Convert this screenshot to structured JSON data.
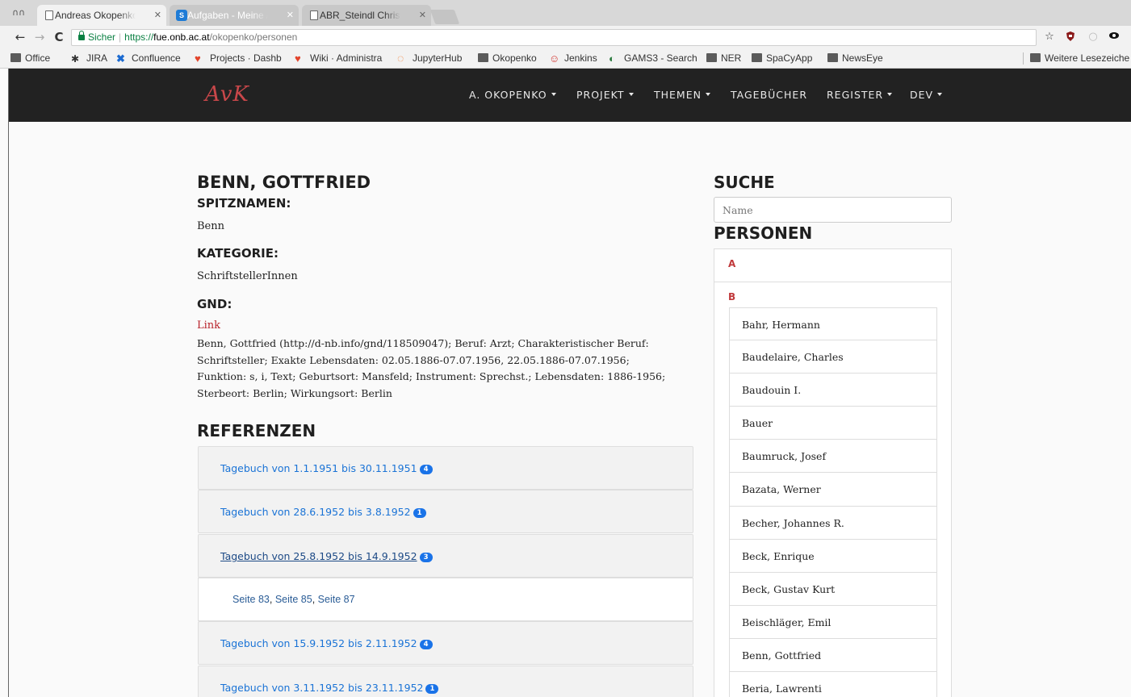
{
  "browser": {
    "tabs": [
      {
        "title": "Andreas Okopenko:",
        "icon": "document-icon",
        "active": true
      },
      {
        "title": "Aufgaben - Meine A",
        "icon": "sharepoint-icon",
        "active": false
      },
      {
        "title": "ABR_Steindl Christo",
        "icon": "document-icon",
        "active": false
      }
    ],
    "address": {
      "secure_label": "Sicher",
      "scheme": "https://",
      "host": "fue.onb.ac.at",
      "path": "/okopenko/personen"
    },
    "bookmarks": [
      {
        "label": "Office",
        "icon": "folder-icon"
      },
      {
        "label": "JIRA",
        "icon": "jira-icon"
      },
      {
        "label": "Confluence",
        "icon": "confluence-icon"
      },
      {
        "label": "Projects · Dashb",
        "icon": "gitlab-icon"
      },
      {
        "label": "Wiki · Administra",
        "icon": "gitlab-icon"
      },
      {
        "label": "JupyterHub",
        "icon": "jupyter-icon"
      },
      {
        "label": "Okopenko",
        "icon": "folder-icon"
      },
      {
        "label": "Jenkins",
        "icon": "jenkins-icon"
      },
      {
        "label": "GAMS3 - Search",
        "icon": "gams-icon"
      },
      {
        "label": "NER",
        "icon": "folder-icon"
      },
      {
        "label": "SpaCyApp",
        "icon": "folder-icon"
      },
      {
        "label": "NewsEye",
        "icon": "folder-icon"
      }
    ],
    "other_bookmarks": "Weitere Lesezeiche"
  },
  "navbar": {
    "brand": "AvK",
    "items": [
      {
        "label": "A. OKOPENKO",
        "dropdown": true
      },
      {
        "label": "PROJEKT",
        "dropdown": true
      },
      {
        "label": "THEMEN",
        "dropdown": true
      },
      {
        "label": "TAGEBÜCHER",
        "dropdown": false
      },
      {
        "label": "REGISTER",
        "dropdown": true
      },
      {
        "label": "DEV",
        "dropdown": true
      }
    ]
  },
  "person": {
    "name": "BENN, GOTTFRIED",
    "nicknames_heading": "SPITZNAMEN:",
    "nicknames": "Benn",
    "category_heading": "KATEGORIE:",
    "category": "SchriftstellerInnen",
    "gnd_heading": "GND:",
    "gnd_link": "Link",
    "gnd_description": "Benn, Gottfried (http://d-nb.info/gnd/118509047); Beruf: Arzt; Charakteristischer Beruf: Schriftsteller; Exakte Lebensdaten: 02.05.1886-07.07.1956, 22.05.1886-07.07.1956; Funktion: s, i, Text; Geburtsort: Mansfeld; Instrument: Sprechst.; Lebensdaten: 1886-1956; Sterbeort: Berlin; Wirkungsort: Berlin"
  },
  "references": {
    "heading": "REFERENZEN",
    "items": [
      {
        "label": "Tagebuch von 1.1.1951 bis 30.11.1951",
        "count": "4"
      },
      {
        "label": "Tagebuch von 28.6.1952 bis 3.8.1952",
        "count": "1"
      },
      {
        "label": "Tagebuch von 25.8.1952 bis 14.9.1952",
        "count": "3",
        "open": true,
        "pages": [
          "Seite 83",
          "Seite 85",
          "Seite 87"
        ]
      },
      {
        "label": "Tagebuch von 15.9.1952 bis 2.11.1952",
        "count": "4"
      },
      {
        "label": "Tagebuch von 3.11.1952 bis 23.11.1952",
        "count": "1"
      }
    ]
  },
  "sidebar": {
    "search_heading": "SUCHE",
    "search_placeholder": "Name",
    "persons_heading": "PERSONEN",
    "letters": [
      "A",
      "B"
    ],
    "persons_b": [
      "Bahr, Hermann",
      "Baudelaire, Charles",
      "Baudouin I.",
      "Bauer",
      "Baumruck, Josef",
      "Bazata, Werner",
      "Becher, Johannes R.",
      "Beck, Enrique",
      "Beck, Gustav Kurt",
      "Beischläger, Emil",
      "Benn, Gottfried",
      "Beria, Lawrenti"
    ]
  },
  "colors": {
    "navbar_bg": "#222222",
    "brand": "#c9474a",
    "link_blue": "#1a73d6",
    "letter_red": "#c0393b",
    "badge": "#1a73e8"
  }
}
